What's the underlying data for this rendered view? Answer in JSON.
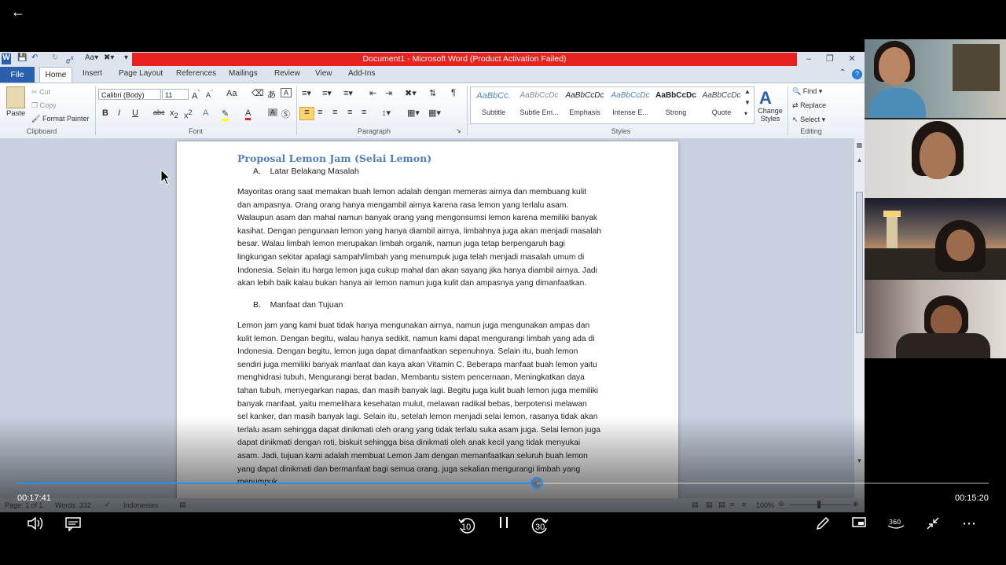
{
  "player": {
    "elapsed": "00:17:41",
    "remaining": "00:15:20",
    "progress": 0.535,
    "skip_back": "10",
    "skip_forward": "30"
  },
  "word": {
    "window_title": "Document1 - Microsoft Word (Product Activation Failed)",
    "tabs": [
      "File",
      "Home",
      "Insert",
      "Page Layout",
      "References",
      "Mailings",
      "Review",
      "View",
      "Add-Ins"
    ],
    "clipboard": {
      "paste": "Paste",
      "cut": "Cut",
      "copy": "Copy",
      "format_painter": "Format Painter",
      "label": "Clipboard"
    },
    "font": {
      "name": "Calibri (Body)",
      "size": "11",
      "label": "Font"
    },
    "paragraph_label": "Paragraph",
    "styles": {
      "label": "Styles",
      "items": [
        {
          "name": "Subtitle",
          "preview": "AaBbCc."
        },
        {
          "name": "Subtle Em...",
          "preview": "AaBbCcDc"
        },
        {
          "name": "Emphasis",
          "preview": "AaBbCcDc"
        },
        {
          "name": "Intense E...",
          "preview": "AaBbCcDc"
        },
        {
          "name": "Strong",
          "preview": "AaBbCcDc"
        },
        {
          "name": "Quote",
          "preview": "AaBbCcDc"
        }
      ],
      "change_styles": "Change Styles"
    },
    "editing": {
      "find": "Find",
      "replace": "Replace",
      "select": "Select",
      "label": "Editing"
    },
    "status": {
      "page": "Page: 1 of 1",
      "words": "Words: 332",
      "language": "Indonesian",
      "zoom": "100%"
    }
  },
  "document": {
    "title": "Proposal Lemon Jam (Selai Lemon)",
    "section_a": "A.    Latar Belakang Masalah",
    "para1": [
      "Mayoritas orang saat memakan buah lemon adalah  dengan memeras airnya dan membuang kulit",
      "dan ampasnya.  Orang orang hanya mengambil airnya karena  rasa lemon yang terlalu asam.",
      "Walaupun asam  dan mahal namun banyak orang yang mengonsumsi lemon karena memiliki banyak",
      "kasihat. Dengan pengunaan lemon yang hanya diambil airnya, limbahnya juga akan menjadi masalah",
      "besar. Walau limbah  lemon merupakan limbah organik, namun juga tetap berpengaruh bagi",
      "lingkungan sekitar apalagi sampah/limbah yang menumpuk juga telah menjadi masalah umum di",
      "Indonesia. Selain itu harga lemon juga cukup mahal dan akan sayang jika hanya diambil airnya. Jadi",
      "akan lebih baik kalau bukan hanya air lemon namun juga kulit dan ampasnya yang dimanfaatkan."
    ],
    "section_b": "B.    Manfaat dan Tujuan",
    "para2": [
      "Lemon jam yang kami buat tidak hanya mengunakan airnya, namun juga mengunakan ampas dan",
      "kulit lemon. Dengan begitu, walau hanya sedikit, namun kami dapat mengurangi limbah yang ada di",
      "Indonesia. Dengan begitu, lemon juga dapat dimanfaatkan sepenuhnya. Selain itu, buah lemon",
      "sendiri juga memiliki banyak manfaat dan kaya akan Vitamin C. Beberapa manfaat buah lemon yaitu",
      "menghidrasi tubuh, Mengurangi berat badan, Membantu sistem pencernaan, Meningkatkan daya",
      "tahan tubuh, menyegarkan napas, dan masih banyak lagi.  Begitu juga kulit buah lemon juga memiliki",
      "banyak manfaat, yaitu memelihara kesehatan mulut, melawan radikal bebas, berpotensi melawan",
      "sel kanker, dan masih banyak lagi.  Selain itu, setelah lemon menjadi selai lemon, rasanya tidak akan",
      "terlalu asam sehingga dapat dinikmati oleh orang yang tidak terlalu suka asam juga. Selai lemon juga",
      "dapat dinikmati dengan roti, biskuit sehingga bisa  dinikmati oleh anak kecil yang tidak menyukai",
      "asam. Jadi, tujuan kami adalah  membuat Lemon Jam dengan memanfaatkan seluruh buah lemon",
      "yang dapat dinikmati dan bermanfaat bagi semua orang, juga sekalian mengurangi limbah yang",
      "menumpuk."
    ]
  }
}
